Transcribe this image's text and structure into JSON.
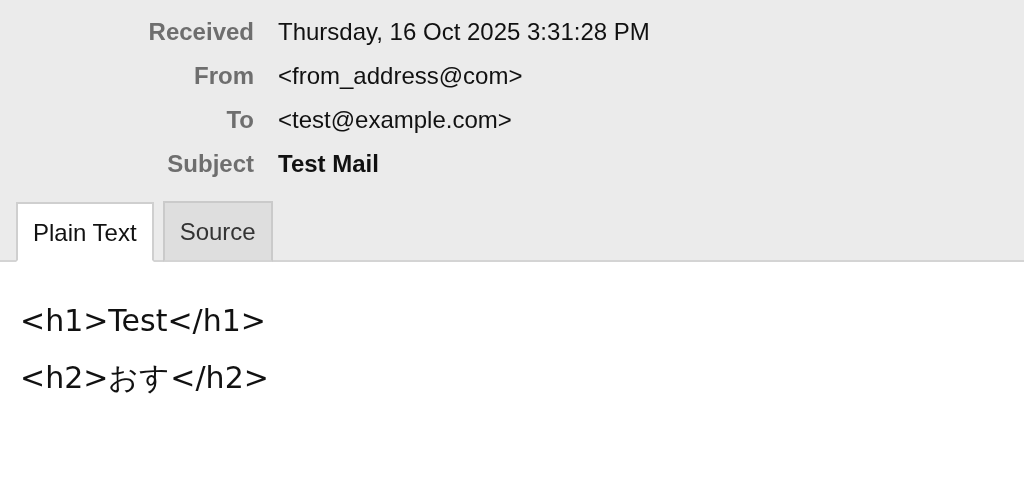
{
  "header": {
    "fields": [
      {
        "label": "Received",
        "value": "Thursday, 16 Oct 2025 3:31:28 PM",
        "bold": false
      },
      {
        "label": "From",
        "value": "<from_address@com>",
        "bold": false
      },
      {
        "label": "To",
        "value": "<test@example.com>",
        "bold": false
      },
      {
        "label": "Subject",
        "value": "Test Mail",
        "bold": true
      }
    ]
  },
  "tabs": [
    {
      "label": "Plain Text",
      "selected": true
    },
    {
      "label": "Source",
      "selected": false
    }
  ],
  "body": {
    "lines": [
      "<h1>Test</h1>",
      "<h2>おす</h2>"
    ]
  }
}
